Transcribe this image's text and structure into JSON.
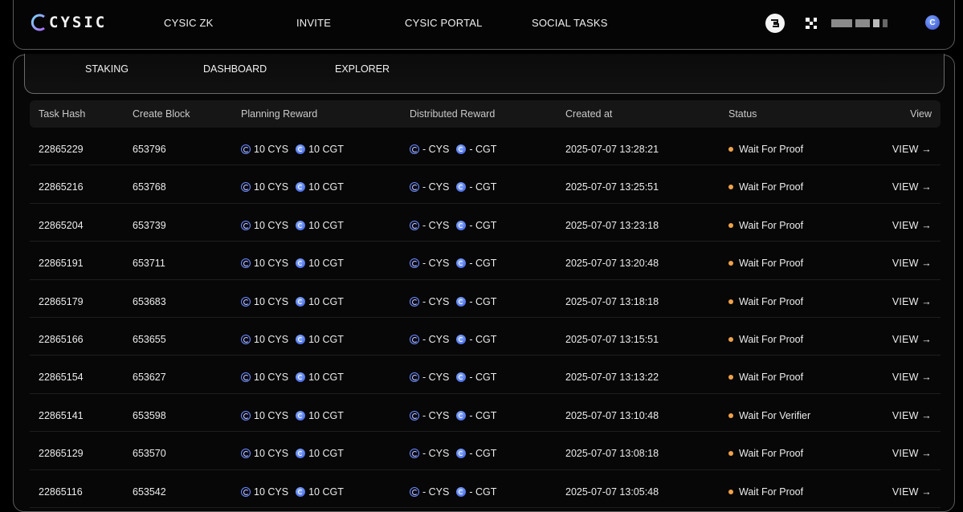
{
  "app": {
    "logo_text": "CYSIC"
  },
  "nav": {
    "items": [
      {
        "label": "CYSIC ZK"
      },
      {
        "label": "INVITE"
      },
      {
        "label": "CYSIC PORTAL"
      },
      {
        "label": "SOCIAL TASKS"
      }
    ]
  },
  "header_icons": {
    "wallet": "wallet-icon",
    "okx": "okx-icon",
    "avatar": "user-avatar",
    "avatar_letter": "C"
  },
  "subnav": {
    "items": [
      {
        "label": "STAKING"
      },
      {
        "label": "DASHBOARD"
      },
      {
        "label": "EXPLORER"
      }
    ]
  },
  "table": {
    "columns": [
      "Task Hash",
      "Create Block",
      "Planning Reward",
      "Distributed Reward",
      "Created at",
      "Status",
      "View"
    ],
    "rows": [
      {
        "hash": "22865229",
        "block": "653796",
        "plan_cys": "10 CYS",
        "plan_cgt": "10 CGT",
        "dist_cys": "- CYS",
        "dist_cgt": "- CGT",
        "created": "2025-07-07 13:28:21",
        "status": "Wait For Proof",
        "view": "VIEW →"
      },
      {
        "hash": "22865216",
        "block": "653768",
        "plan_cys": "10 CYS",
        "plan_cgt": "10 CGT",
        "dist_cys": "- CYS",
        "dist_cgt": "- CGT",
        "created": "2025-07-07 13:25:51",
        "status": "Wait For Proof",
        "view": "VIEW →"
      },
      {
        "hash": "22865204",
        "block": "653739",
        "plan_cys": "10 CYS",
        "plan_cgt": "10 CGT",
        "dist_cys": "- CYS",
        "dist_cgt": "- CGT",
        "created": "2025-07-07 13:23:18",
        "status": "Wait For Proof",
        "view": "VIEW →"
      },
      {
        "hash": "22865191",
        "block": "653711",
        "plan_cys": "10 CYS",
        "plan_cgt": "10 CGT",
        "dist_cys": "- CYS",
        "dist_cgt": "- CGT",
        "created": "2025-07-07 13:20:48",
        "status": "Wait For Proof",
        "view": "VIEW →"
      },
      {
        "hash": "22865179",
        "block": "653683",
        "plan_cys": "10 CYS",
        "plan_cgt": "10 CGT",
        "dist_cys": "- CYS",
        "dist_cgt": "- CGT",
        "created": "2025-07-07 13:18:18",
        "status": "Wait For Proof",
        "view": "VIEW →"
      },
      {
        "hash": "22865166",
        "block": "653655",
        "plan_cys": "10 CYS",
        "plan_cgt": "10 CGT",
        "dist_cys": "- CYS",
        "dist_cgt": "- CGT",
        "created": "2025-07-07 13:15:51",
        "status": "Wait For Proof",
        "view": "VIEW →"
      },
      {
        "hash": "22865154",
        "block": "653627",
        "plan_cys": "10 CYS",
        "plan_cgt": "10 CGT",
        "dist_cys": "- CYS",
        "dist_cgt": "- CGT",
        "created": "2025-07-07 13:13:22",
        "status": "Wait For Proof",
        "view": "VIEW →"
      },
      {
        "hash": "22865141",
        "block": "653598",
        "plan_cys": "10 CYS",
        "plan_cgt": "10 CGT",
        "dist_cys": "- CYS",
        "dist_cgt": "- CGT",
        "created": "2025-07-07 13:10:48",
        "status": "Wait For Verifier",
        "view": "VIEW →"
      },
      {
        "hash": "22865129",
        "block": "653570",
        "plan_cys": "10 CYS",
        "plan_cgt": "10 CGT",
        "dist_cys": "- CYS",
        "dist_cgt": "- CGT",
        "created": "2025-07-07 13:08:18",
        "status": "Wait For Proof",
        "view": "VIEW →"
      },
      {
        "hash": "22865116",
        "block": "653542",
        "plan_cys": "10 CYS",
        "plan_cgt": "10 CGT",
        "dist_cys": "- CYS",
        "dist_cgt": "- CGT",
        "created": "2025-07-07 13:05:48",
        "status": "Wait For Proof",
        "view": "VIEW →"
      }
    ]
  },
  "colors": {
    "status_dot": "#f0a24a",
    "accent_blue": "#4e6ff0",
    "background": "#000000"
  }
}
